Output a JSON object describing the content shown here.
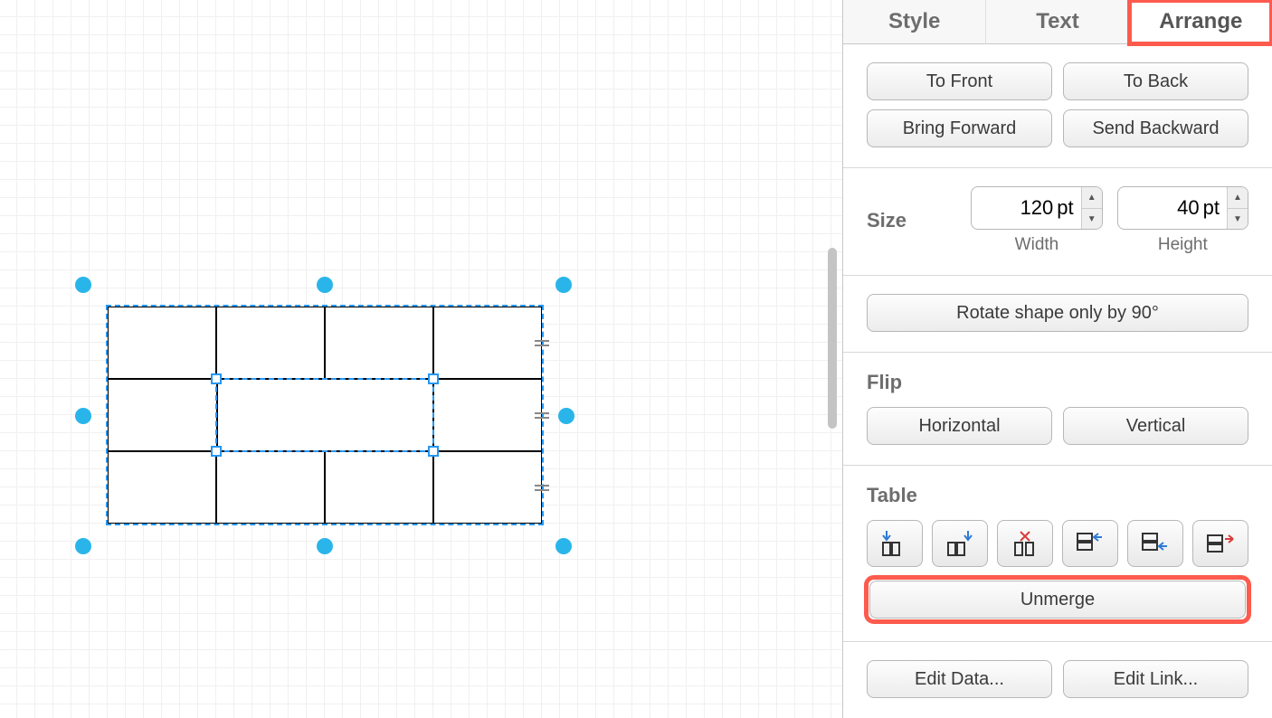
{
  "tabs": {
    "style": "Style",
    "text": "Text",
    "arrange": "Arrange",
    "active": "arrange"
  },
  "zorder": {
    "to_front": "To Front",
    "to_back": "To Back",
    "bring_forward": "Bring Forward",
    "send_backward": "Send Backward"
  },
  "size": {
    "label": "Size",
    "width_value": "120",
    "height_value": "40",
    "unit": "pt",
    "width_label": "Width",
    "height_label": "Height"
  },
  "rotate": {
    "button": "Rotate shape only by 90°"
  },
  "flip": {
    "label": "Flip",
    "horizontal": "Horizontal",
    "vertical": "Vertical"
  },
  "table": {
    "label": "Table",
    "icons": [
      "insert-column-left-icon",
      "insert-column-right-icon",
      "delete-column-icon",
      "insert-row-above-icon",
      "insert-row-below-icon",
      "delete-row-icon"
    ],
    "unmerge": "Unmerge"
  },
  "edit": {
    "data": "Edit Data...",
    "link": "Edit Link..."
  },
  "colors": {
    "accent": "#29b5ea",
    "highlight": "#fd5b4e",
    "selection": "#2597f3"
  }
}
